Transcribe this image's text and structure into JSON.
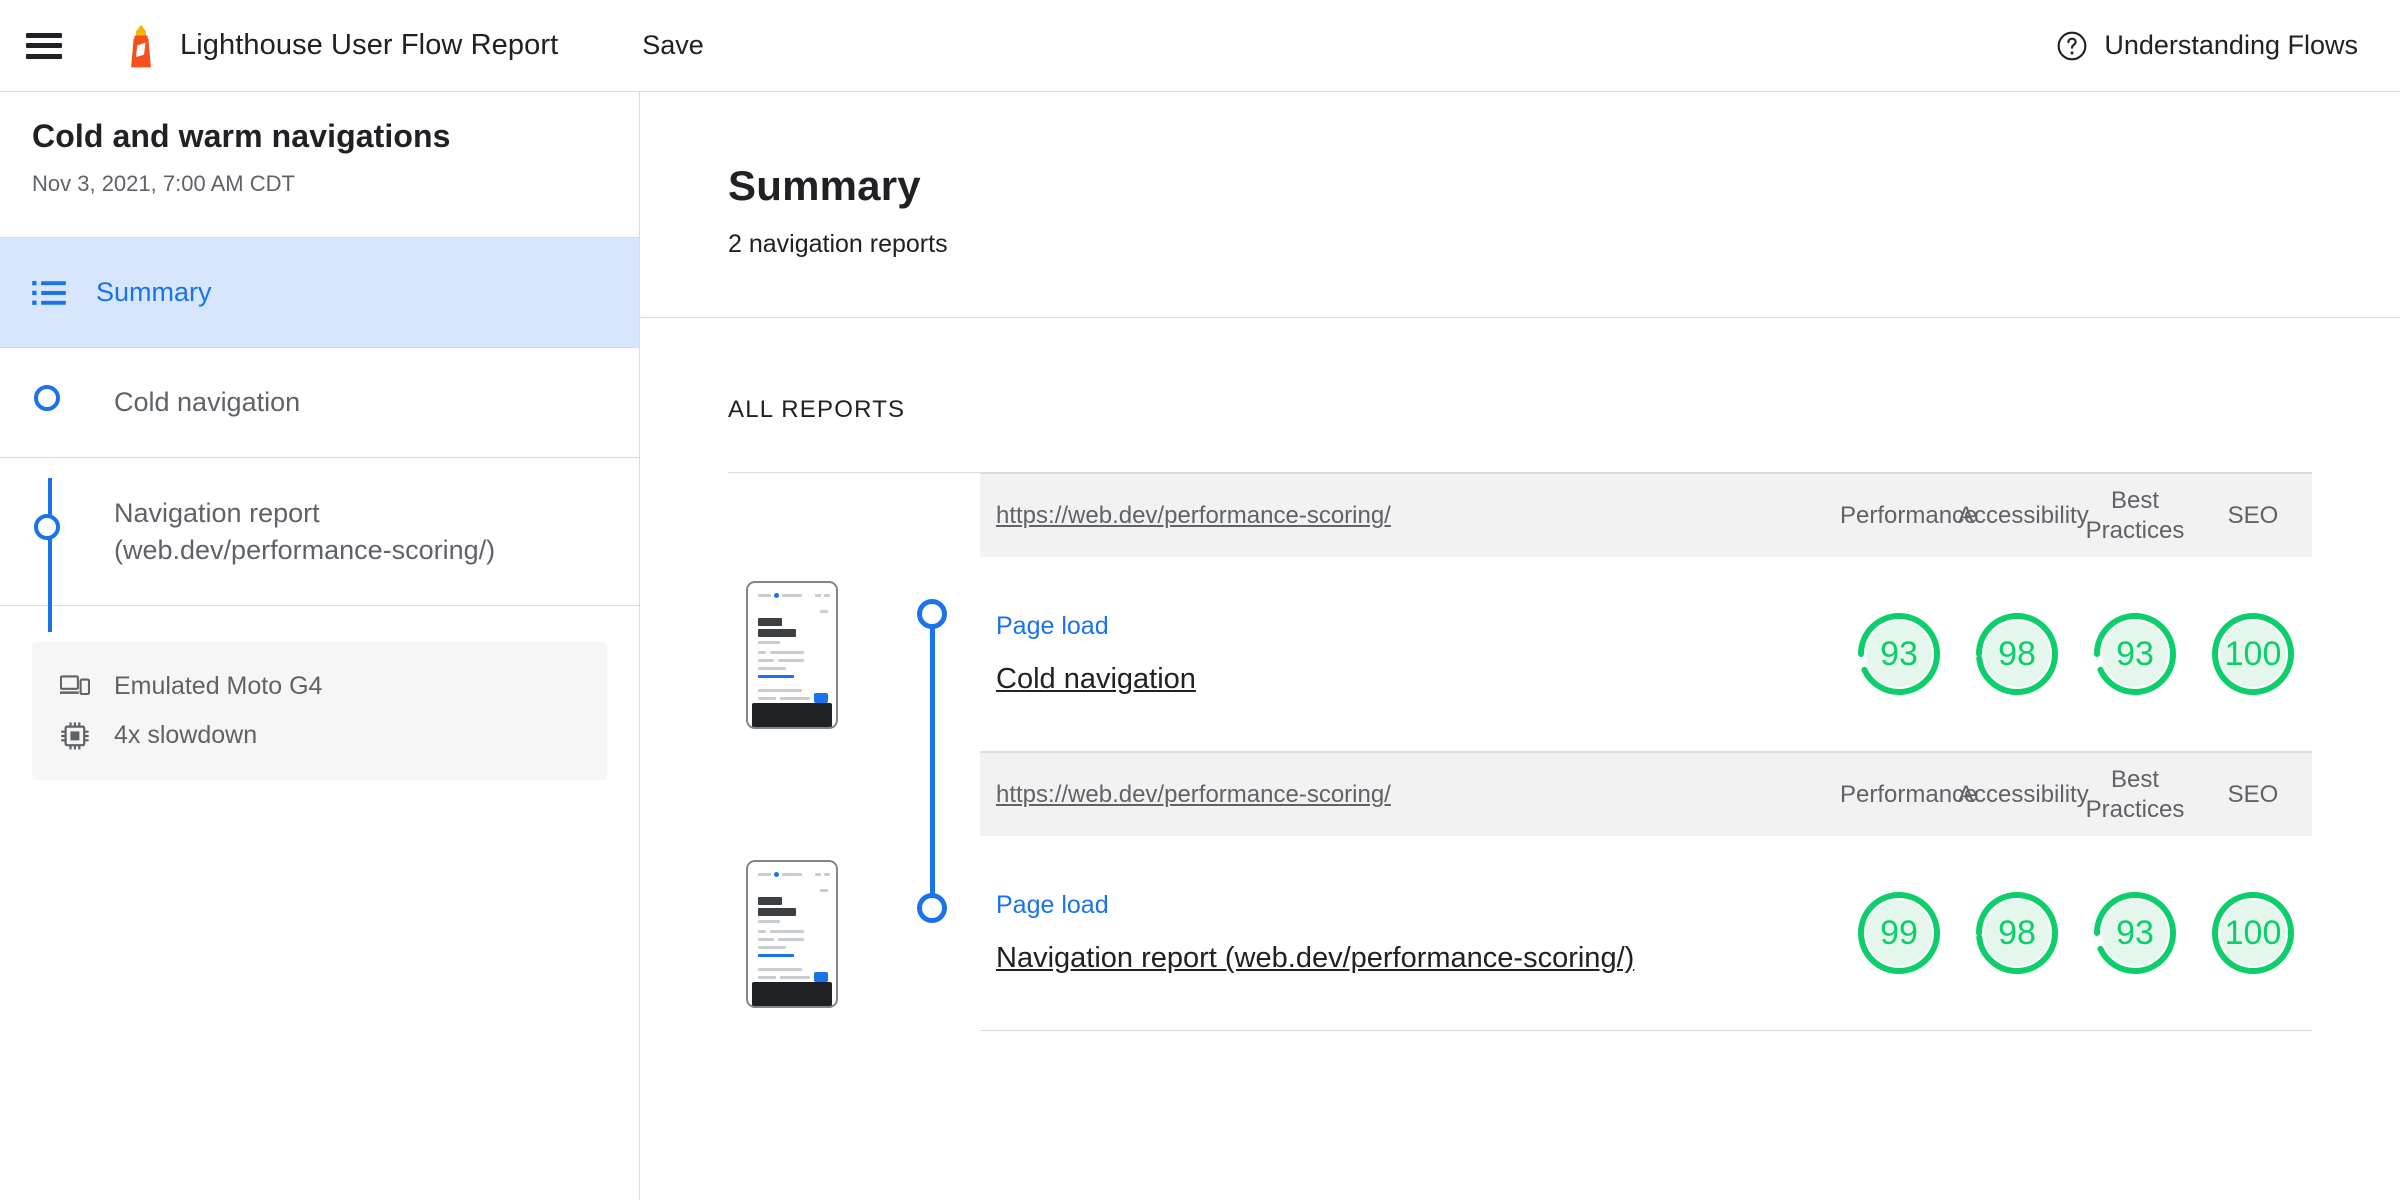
{
  "topbar": {
    "menu_icon": "hamburger-menu-icon",
    "logo_icon": "lighthouse-icon",
    "title": "Lighthouse User Flow Report",
    "save_label": "Save",
    "help_icon": "help-circle-icon",
    "help_label": "Understanding Flows"
  },
  "sidebar": {
    "flow_title": "Cold and warm navigations",
    "flow_date": "Nov 3, 2021, 7:00 AM CDT",
    "summary_item": {
      "label": "Summary",
      "icon": "list-icon",
      "selected": true
    },
    "steps": [
      {
        "label": "Cold navigation",
        "icon": "step-circle-icon"
      },
      {
        "label": "Navigation report (web.dev/performance-scoring/)",
        "icon": "step-circle-icon"
      }
    ],
    "device": {
      "emulation_icon": "devices-icon",
      "emulation": "Emulated Moto G4",
      "cpu_icon": "cpu-chip-icon",
      "throttling": "4x slowdown"
    }
  },
  "main": {
    "title": "Summary",
    "subtitle": "2 navigation reports",
    "all_reports_label": "ALL REPORTS",
    "categories": [
      "Performance",
      "Accessibility",
      "Best Practices",
      "SEO"
    ],
    "reports": [
      {
        "url": "https://web.dev/performance-scoring/",
        "gather_mode": "Page load",
        "name": "Cold navigation",
        "scores": [
          93,
          98,
          93,
          100
        ],
        "thumbnail": "mobile-screenshot-thumbnail"
      },
      {
        "url": "https://web.dev/performance-scoring/",
        "gather_mode": "Page load",
        "name": "Navigation report (web.dev/performance-scoring/)",
        "scores": [
          99,
          98,
          93,
          100
        ],
        "thumbnail": "mobile-screenshot-thumbnail"
      }
    ]
  },
  "colors": {
    "accent_blue": "#1a73e8",
    "pass_green": "#0cce6b",
    "pass_green_bg": "#e5f7ed",
    "lighthouse_orange": "#f4511e",
    "selected_bg": "#d7e6fd",
    "header_strip": "#f2f2f2",
    "text_primary": "#202124",
    "text_secondary": "#5f6368",
    "border": "#dadce0"
  }
}
